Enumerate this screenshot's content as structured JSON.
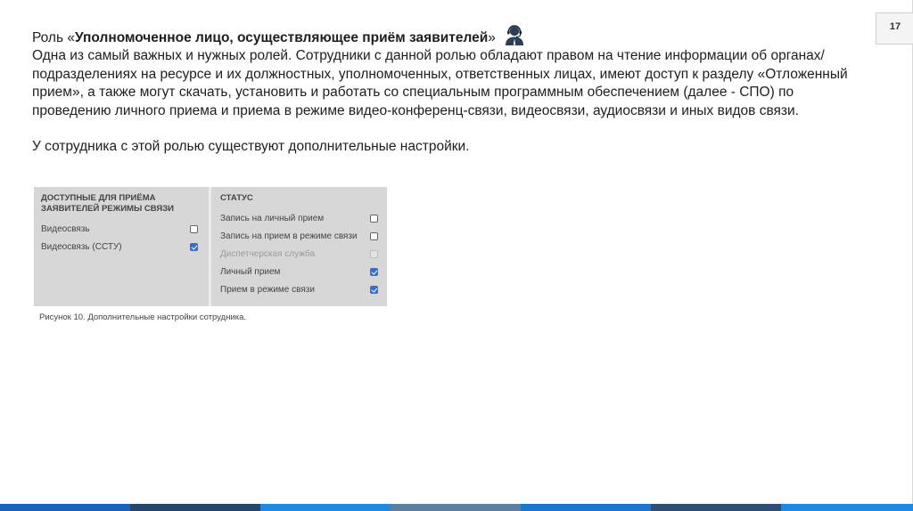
{
  "page": {
    "number": "17"
  },
  "text": {
    "heading_prefix": "Роль «",
    "heading_bold": "Уполномоченное лицо, осуществляющее приём заявителей",
    "heading_suffix": "»",
    "paragraph1": "Одна из самый важных и нужных ролей. Сотрудники с данной ролью обладают правом на чтение информации об органах/подразделениях на ресурсе и их должностных, уполномоченных, ответственных лицах, имеют доступ к разделу «Отложенный прием», а также могут скачать, установить и работать со специальным программным обеспечением (далее - СПО) по проведению личного приема и приема в режиме видео-конференц-связи, видеосвязи, аудиосвязи и иных видов связи.",
    "paragraph2": "У сотрудника с этой ролью существуют дополнительные настройки."
  },
  "icons": {
    "role": "operator-headset-icon"
  },
  "figure": {
    "left_panel": {
      "title": "Доступные для приёма заявителей режимы связи",
      "options": [
        {
          "label": "Видеосвязь",
          "checked": false,
          "disabled": false
        },
        {
          "label": "Видеосвязь (ССТУ)",
          "checked": true,
          "disabled": false
        }
      ]
    },
    "right_panel": {
      "title": "Статус",
      "options": [
        {
          "label": "Запись на личный прием",
          "checked": false,
          "disabled": false
        },
        {
          "label": "Запись на прием в режиме связи",
          "checked": false,
          "disabled": false
        },
        {
          "label": "Диспетчерская служба",
          "checked": false,
          "disabled": true
        },
        {
          "label": "Личный прием",
          "checked": true,
          "disabled": false
        },
        {
          "label": "Прием в режиме связи",
          "checked": true,
          "disabled": false
        }
      ]
    },
    "caption": "Рисунок 10. Дополнительные настройки сотрудника."
  },
  "colors": {
    "checkbox_checked": "#2f6fd6",
    "panel_background": "#d7d7d7",
    "bottom_bar": [
      "#1565c0",
      "#27466d",
      "#1e88e5",
      "#5d7ea0",
      "#1976d2",
      "#2e4f73",
      "#1e88e5"
    ]
  }
}
